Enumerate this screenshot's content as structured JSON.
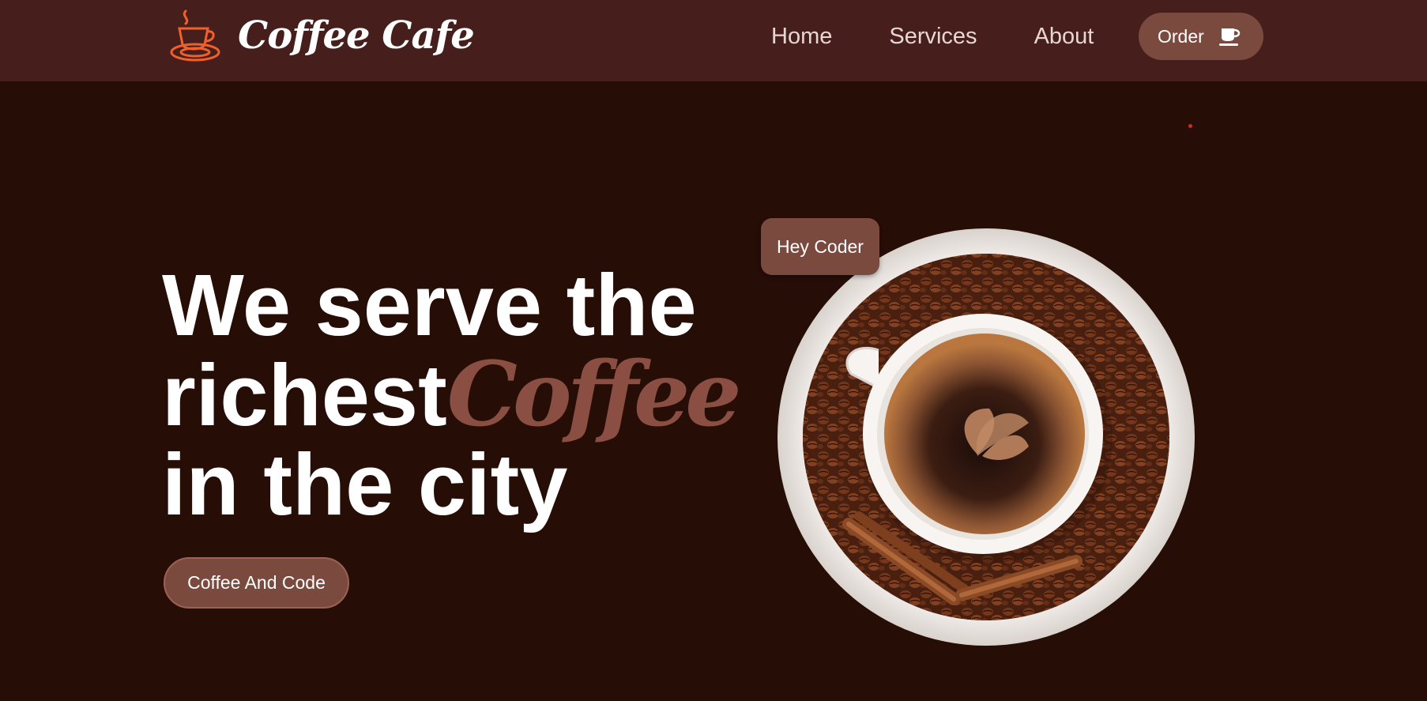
{
  "brand": {
    "name": "Coffee Cafe",
    "logo_icon": "coffee-cup-logo-icon",
    "logo_color": "#f0602a"
  },
  "nav": {
    "items": [
      {
        "label": "Home"
      },
      {
        "label": "Services"
      },
      {
        "label": "About"
      }
    ],
    "order_label": "Order",
    "order_icon": "coffee-cup-icon"
  },
  "hero": {
    "line1": "We serve the",
    "line2_plain": "richest",
    "line2_accent": "Coffee",
    "line3": "in the city",
    "cta_label": "Coffee And Code",
    "badge_label": "Hey Coder",
    "image_subject": "coffee-cup-on-saucer-with-beans-image"
  },
  "colors": {
    "background": "#260d06",
    "navbar": "#461f1d",
    "accent": "#7a4a3f",
    "accent_text": "#8a4f42"
  }
}
